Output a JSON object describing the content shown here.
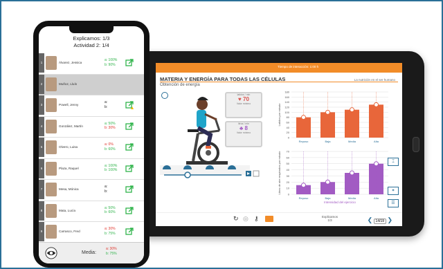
{
  "phone": {
    "header_line1": "Explicamos: 1/3",
    "header_line2": "Actividad 2: 1/4",
    "students": [
      {
        "num": "1",
        "name": "Álvarez, Jessica",
        "a": "a: 100%",
        "b": "b: 90%",
        "a_color": "green",
        "b_color": "green",
        "icon": "external-link-icon",
        "selected": false
      },
      {
        "num": "2",
        "name": "Muñoz, Lluís",
        "a": "",
        "b": "",
        "a_color": "",
        "b_color": "",
        "icon": "",
        "selected": true
      },
      {
        "num": "3",
        "name": "Powell, Jenny",
        "a": "a:",
        "b": "b:",
        "a_color": "",
        "b_color": "",
        "icon": "external-link-warning-icon",
        "selected": false
      },
      {
        "num": "4",
        "name": "González, Martín",
        "a": "a: 50%",
        "b": "b: 30%",
        "a_color": "green",
        "b_color": "red",
        "icon": "external-link-icon",
        "selected": false
      },
      {
        "num": "5",
        "name": "Olvero, Luisa",
        "a": "a: 0%",
        "b": "b: 60%",
        "a_color": "red",
        "b_color": "green",
        "icon": "external-link-icon",
        "selected": false
      },
      {
        "num": "6",
        "name": "Plaza, Raquel",
        "a": "a: 100%",
        "b": "b: 100%",
        "a_color": "green",
        "b_color": "green",
        "icon": "external-link-icon",
        "selected": false
      },
      {
        "num": "7",
        "name": "Mesa, Mónica",
        "a": "a:",
        "b": "b:",
        "a_color": "",
        "b_color": "",
        "icon": "external-link-icon",
        "selected": false
      },
      {
        "num": "8",
        "name": "Mata, Lucía",
        "a": "a: 50%",
        "b": "b: 60%",
        "a_color": "green",
        "b_color": "green",
        "icon": "external-link-icon",
        "selected": false
      },
      {
        "num": "9",
        "name": "Carrasco, Fred",
        "a": "a: 30%",
        "b": "b: 75%",
        "a_color": "red",
        "b_color": "green",
        "icon": "external-link-icon",
        "selected": false
      }
    ],
    "footer_label": "Media:",
    "footer_a": "a: 30%",
    "footer_b": "b: 75%"
  },
  "tablet": {
    "topbar_text": "Tiempo de interacción: 1:00 h",
    "lesson_title": "MATERIA Y ENERGÍA PARA TODAS LAS CÉLULAS",
    "lesson_subtitle": "Obtención de energía",
    "lesson_section": "La nutrición en el ser humano",
    "monitor1_label": "latidos / min",
    "monitor1_value": "70",
    "monitor1_sub": "Valor mínimo",
    "monitor2_label": "litros / min",
    "monitor2_value": "8",
    "monitor2_sub": "Valor mínimo",
    "footer_section": "Explicamos",
    "footer_section_sub": "1/3",
    "pager": "14/19"
  },
  "colors": {
    "accent": "#f28c28",
    "green": "#2fb34a",
    "red": "#e0342b",
    "frame": "#2a6f97",
    "bar_orange": "#e8663a",
    "bar_purple": "#a25bc3"
  },
  "chart_data": [
    {
      "type": "bar",
      "ylabel": "Latidos por minuto",
      "categories": [
        "Reposo",
        "Baja",
        "Media",
        "Alta"
      ],
      "values": [
        80,
        100,
        110,
        130
      ],
      "ylim": [
        0,
        180
      ],
      "yticks": [
        "180",
        "160",
        "140",
        "120",
        "100",
        "80",
        "60",
        "40",
        "20",
        "0"
      ]
    },
    {
      "type": "bar",
      "ylabel": "Litros de aire respirados por minuto",
      "xlabel": "Intensidad del ejercicio",
      "categories": [
        "Reposo",
        "Baja",
        "Media",
        "Alta"
      ],
      "values": [
        15,
        20,
        35,
        50
      ],
      "ylim": [
        0,
        70
      ],
      "yticks": [
        "70",
        "60",
        "50",
        "40",
        "30",
        "20",
        "10",
        "0"
      ]
    }
  ]
}
